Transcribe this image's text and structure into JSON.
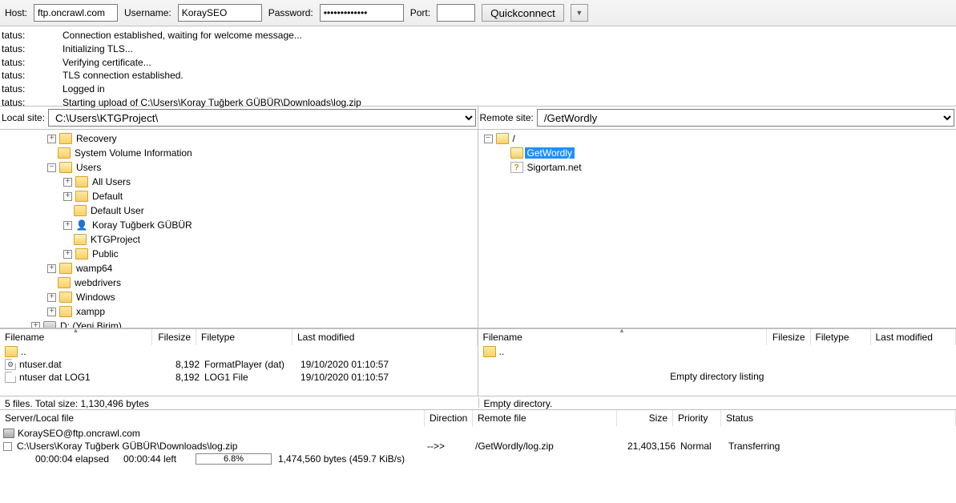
{
  "toolbar": {
    "host_label": "Host:",
    "host_value": "ftp.oncrawl.com",
    "user_label": "Username:",
    "user_value": "KoraySEO",
    "pass_label": "Password:",
    "pass_value": "•••••••••••••",
    "port_label": "Port:",
    "port_value": "",
    "quickconnect": "Quickconnect"
  },
  "log": {
    "status_label": "tatus:",
    "lines": [
      "Connection established, waiting for welcome message...",
      "Initializing TLS...",
      "Verifying certificate...",
      "TLS connection established.",
      "Logged in",
      "Starting upload of C:\\Users\\Koray Tuğberk GÜBÜR\\Downloads\\log.zip"
    ]
  },
  "local": {
    "label": "Local site:",
    "path": "C:\\Users\\KTGProject\\",
    "tree": {
      "l1": "Recovery",
      "l2": "System Volume Information",
      "l3": "Users",
      "l3a": "All Users",
      "l3b": "Default",
      "l3c": "Default User",
      "l3d": "Koray Tuğberk GÜBÜR",
      "l3e": "KTGProject",
      "l3f": "Public",
      "l4": "wamp64",
      "l5": "webdrivers",
      "l6": "Windows",
      "l7": "xampp",
      "l8": "D: (Yeni Birim)"
    },
    "file_headers": {
      "name": "Filename",
      "size": "Filesize",
      "type": "Filetype",
      "mod": "Last modified"
    },
    "rows": {
      "parent": "..",
      "r1": {
        "name": "ntuser.dat",
        "size": "8,192",
        "type": "FormatPlayer (dat)",
        "mod": "19/10/2020 01:10:57"
      },
      "r2": {
        "name": "ntuser dat LOG1",
        "size": "8,192",
        "type": "LOG1 File",
        "mod": "19/10/2020 01:10:57"
      }
    },
    "status": "5 files. Total size: 1,130,496 bytes"
  },
  "remote": {
    "label": "Remote site:",
    "path": "/GetWordly",
    "tree": {
      "root": "/",
      "a": "GetWordly",
      "b": "Sigortam.net"
    },
    "file_headers": {
      "name": "Filename",
      "size": "Filesize",
      "type": "Filetype",
      "mod": "Last modified"
    },
    "parent": "..",
    "empty": "Empty directory listing",
    "status": "Empty directory."
  },
  "queue": {
    "headers": {
      "sl": "Server/Local file",
      "dir": "Direction",
      "rf": "Remote file",
      "size": "Size",
      "prio": "Priority",
      "status": "Status"
    },
    "server": "KoraySEO@ftp.oncrawl.com",
    "row": {
      "local": "C:\\Users\\Koray Tuğberk GÜBÜR\\Downloads\\log.zip",
      "dir": "-->>",
      "remote": "/GetWordly/log.zip",
      "size": "21,403,156",
      "prio": "Normal",
      "status": "Transferring"
    },
    "progress": {
      "elapsed": "00:00:04 elapsed",
      "left": "00:00:44 left",
      "pct": "6.8%",
      "bytes": "1,474,560 bytes (459.7 KiB/s)"
    }
  }
}
